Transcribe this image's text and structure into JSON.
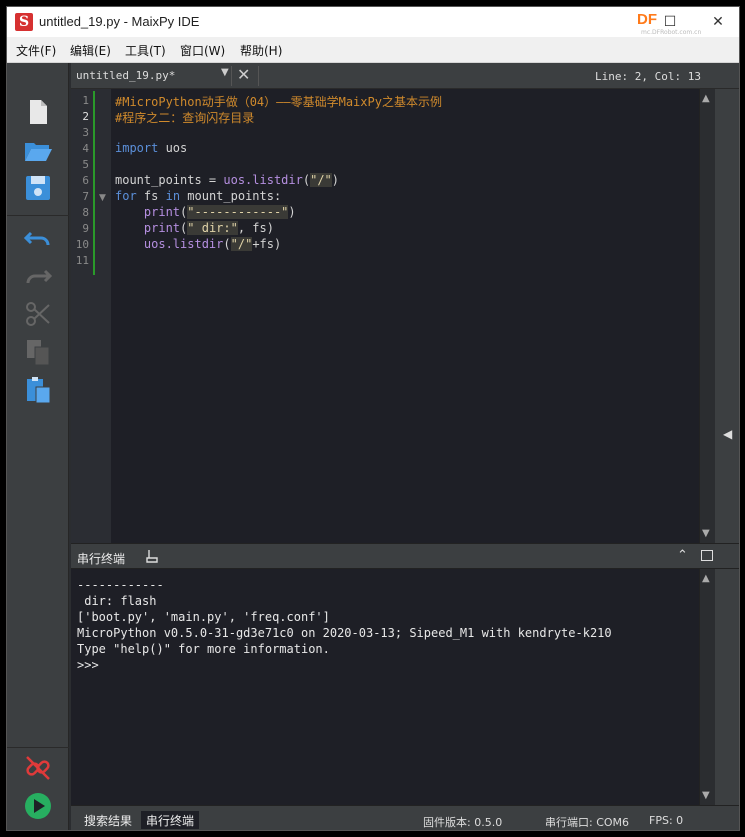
{
  "window": {
    "title": "untitled_19.py - MaixPy IDE",
    "app_icon_letter": "S",
    "watermark": "DF",
    "watermark_sub": "mc.DFRobot.com.cn"
  },
  "menu": [
    "文件(F)",
    "编辑(E)",
    "工具(T)",
    "窗口(W)",
    "帮助(H)"
  ],
  "editor_tab": {
    "file_name": "untitled_19.py*",
    "cursor": "Line: 2, Col: 13"
  },
  "code_lines": [
    {
      "num": "1",
      "text": "#MicroPython动手做（04）——零基础学MaixPy之基本示例"
    },
    {
      "num": "2",
      "text": "#程序之二：查询闪存目录"
    },
    {
      "num": "3",
      "text": ""
    },
    {
      "num": "4",
      "kw": "import",
      "rest": " uos"
    },
    {
      "num": "5",
      "text": ""
    },
    {
      "num": "6",
      "pre": "mount_points = ",
      "fn": "uos.listdir",
      "open": "(",
      "str": "\"/\"",
      "close": ")"
    },
    {
      "num": "7",
      "kw": "for",
      "mid": " fs ",
      "kw2": "in",
      "rest": " mount_points:"
    },
    {
      "num": "8",
      "indent": "    ",
      "fn": "print",
      "open": "(",
      "str": "\"------------\"",
      "close": ")"
    },
    {
      "num": "9",
      "indent": "    ",
      "fn": "print",
      "open": "(",
      "str": "\" dir:\"",
      "close": ", fs)"
    },
    {
      "num": "10",
      "indent": "    ",
      "fn": "uos.listdir",
      "open": "(",
      "str": "\"/\"",
      "close": "+fs)"
    },
    {
      "num": "11",
      "text": ""
    }
  ],
  "terminal": {
    "title": "串行终端",
    "lines": [
      "------------",
      " dir: flash",
      "['boot.py', 'main.py', 'freq.conf']",
      "MicroPython v0.5.0-31-gd3e71c0 on 2020-03-13; Sipeed_M1 with kendryte-k210",
      "Type \"help()\" for more information.",
      ">>>"
    ]
  },
  "status": {
    "tab_search": "搜索结果",
    "tab_serial": "串行终端",
    "firmware": "固件版本: 0.5.0",
    "port": "串行端口: COM6",
    "fps": "FPS: 0"
  },
  "colors": {
    "comment": "#d08a2c",
    "keyword": "#5b8fd9",
    "function": "#b58fe0",
    "accent_blue": "#3b8fd9",
    "run_green": "#27ae60",
    "disconnect_red": "#e03a3a"
  }
}
